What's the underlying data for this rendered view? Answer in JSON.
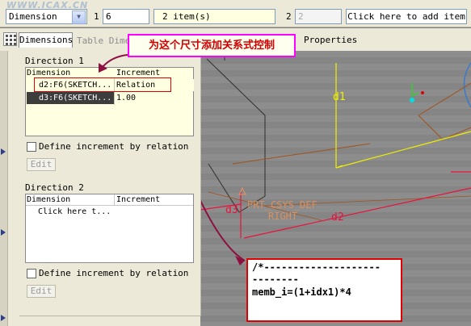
{
  "watermark": "WWW.ICAX.CN",
  "toolbar": {
    "dimension_select": "Dimension",
    "label_1": "1",
    "field_1_value": "6",
    "items_summary": "2 item(s)",
    "label_2": "2",
    "field_2_value": "2",
    "add_item_button": "Click here to add item"
  },
  "tabs": {
    "dimensions": "Dimensions",
    "table": "Table Dimen",
    "properties": "Properties"
  },
  "callout_text": "为这个尺寸添加关系式控制",
  "direction1": {
    "title": "Direction 1",
    "header_dimension": "Dimension",
    "header_increment": "Increment",
    "rows": [
      {
        "dimension": "d2:F6(SKETCH...",
        "increment": "Relation"
      },
      {
        "dimension": "d3:F6(SKETCH...",
        "increment": "1.00"
      }
    ],
    "checkbox_label": "Define increment by relation",
    "edit_button": "Edit"
  },
  "direction2": {
    "title": "Direction 2",
    "header_dimension": "Dimension",
    "header_increment": "Increment",
    "placeholder_row": "Click here t...",
    "checkbox_label": "Define increment by relation",
    "edit_button": "Edit"
  },
  "cad_labels": {
    "d1": "d1",
    "d2": "d2",
    "d3": "d3",
    "csys": "PRT_CSYS_DEF",
    "right": "RIGHT"
  },
  "relation_editor": {
    "line1": "/*--------------------",
    "line2": "--------",
    "line3": "memb_i=(1+idx1)*4"
  },
  "colors": {
    "callout_border": "#ff00ff",
    "callout_text": "#d10000",
    "highlight_box": "#e00000",
    "selected_row": "#3d3d3d",
    "cad_dimension_red": "#e8123c",
    "cad_dimension_yellow": "#f0f000"
  }
}
